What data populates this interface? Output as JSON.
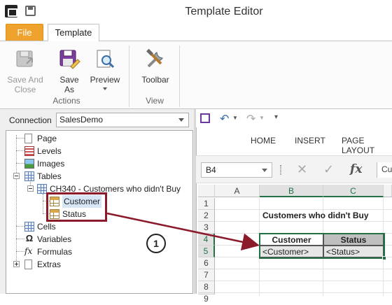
{
  "window": {
    "title": "Template Editor"
  },
  "ribbon": {
    "tabs": [
      "File",
      "Template"
    ],
    "buttons": {
      "save_and_close": "Save And Close",
      "save_as": "Save As",
      "preview": "Preview",
      "toolbar": "Toolbar"
    },
    "groups": {
      "actions": "Actions",
      "view": "View"
    }
  },
  "connection": {
    "label": "Connection",
    "value": "SalesDemo"
  },
  "tree": {
    "items": {
      "page": "Page",
      "levels": "Levels",
      "images": "Images",
      "tables": "Tables",
      "table_ch340": "CH340 - Customers who didn't Buy",
      "customer": "Customer",
      "status": "Status",
      "cells": "Cells",
      "variables": "Variables",
      "formulas": "Formulas",
      "extras": "Extras"
    }
  },
  "excel": {
    "tabs": [
      "HOME",
      "INSERT",
      "PAGE LAYOUT"
    ],
    "name_box": "B4",
    "formula_value": "Cu",
    "columns": [
      "A",
      "B",
      "C"
    ],
    "rows": [
      "1",
      "2",
      "3",
      "4",
      "5",
      "6",
      "7",
      "8",
      "9"
    ],
    "cells": {
      "title": "Customers who didn't Buy",
      "hdr_customer": "Customer",
      "hdr_status": "Status",
      "val_customer": "<Customer>",
      "val_status": "<Status>"
    }
  },
  "callout": {
    "number": "1"
  },
  "colors": {
    "file_tab": "#f0a22e",
    "highlight": "#8b1a2b",
    "excel_green": "#217346"
  }
}
